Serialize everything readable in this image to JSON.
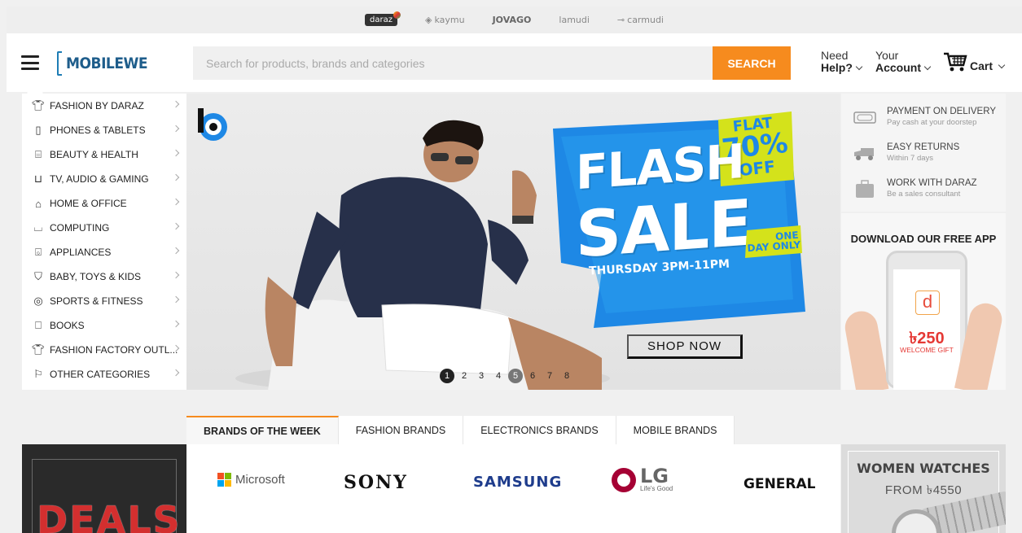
{
  "partners": [
    {
      "name": "daraz"
    },
    {
      "name": "kaymu"
    },
    {
      "name": "JOVAGO"
    },
    {
      "name": "lamudi"
    },
    {
      "name": "carmudi"
    }
  ],
  "header": {
    "logo": "MOBILEWE",
    "search_placeholder": "Search for products, brands and categories",
    "search_button": "SEARCH",
    "help_line1": "Need",
    "help_line2": "Help?",
    "account_line1": "Your",
    "account_line2": "Account",
    "cart_label": "Cart"
  },
  "categories": [
    {
      "label": "FASHION BY DARAZ",
      "icon": "shirt-icon"
    },
    {
      "label": "PHONES & TABLETS",
      "icon": "phone-icon"
    },
    {
      "label": "BEAUTY & HEALTH",
      "icon": "beauty-icon"
    },
    {
      "label": "TV, AUDIO & GAMING",
      "icon": "tv-icon"
    },
    {
      "label": "HOME & OFFICE",
      "icon": "home-icon"
    },
    {
      "label": "COMPUTING",
      "icon": "laptop-icon"
    },
    {
      "label": "APPLIANCES",
      "icon": "appliance-icon"
    },
    {
      "label": "BABY, TOYS & KIDS",
      "icon": "baby-icon"
    },
    {
      "label": "SPORTS & FITNESS",
      "icon": "ball-icon"
    },
    {
      "label": "BOOKS",
      "icon": "book-icon"
    },
    {
      "label": "FASHION FACTORY OUTL...",
      "icon": "shirt-icon"
    },
    {
      "label": "OTHER CATEGORIES",
      "icon": "flag-icon"
    }
  ],
  "hero": {
    "flat": "FLAT",
    "percent": "70%",
    "off": "OFF",
    "flash": "FLASH",
    "sale": "SALE",
    "one": "ONE",
    "day_only": "DAY ONLY",
    "thursday": "THURSDAY 3PM-11PM",
    "cta": "SHOP NOW",
    "slides": [
      "1",
      "2",
      "3",
      "4",
      "5",
      "6",
      "7",
      "8"
    ],
    "active_slide": "1"
  },
  "info": {
    "items": [
      {
        "title": "PAYMENT ON DELIVERY",
        "subtitle": "Pay cash at your doorstep",
        "icon": "cash-icon"
      },
      {
        "title": "EASY RETURNS",
        "subtitle": "Within 7 days",
        "icon": "truck-icon"
      },
      {
        "title": "WORK WITH DARAZ",
        "subtitle": "Be a sales consultant",
        "icon": "briefcase-icon"
      }
    ],
    "app_title": "DOWNLOAD OUR FREE APP",
    "app_letter": "d",
    "gift_amount": "৳250",
    "gift_label": "WELCOME GIFT"
  },
  "brands": {
    "tabs": [
      "BRANDS OF THE WEEK",
      "FASHION BRANDS",
      "ELECTRONICS BRANDS",
      "MOBILE BRANDS"
    ],
    "active_tab": "BRANDS OF THE WEEK",
    "logos": {
      "microsoft": "Microsoft",
      "sony": "SONY",
      "samsung": "SAMSUNG",
      "lg": "LG",
      "lg_tag": "Life's Good",
      "general": "GENERAL"
    }
  },
  "promos": {
    "deals": "DEALS",
    "watches_title": "WOMEN WATCHES",
    "watches_sub": "FROM ৳4550"
  },
  "colors": {
    "accent": "#f68b1e",
    "brand_blue": "#1e88e5",
    "flash_yellow": "#d4e21b"
  }
}
